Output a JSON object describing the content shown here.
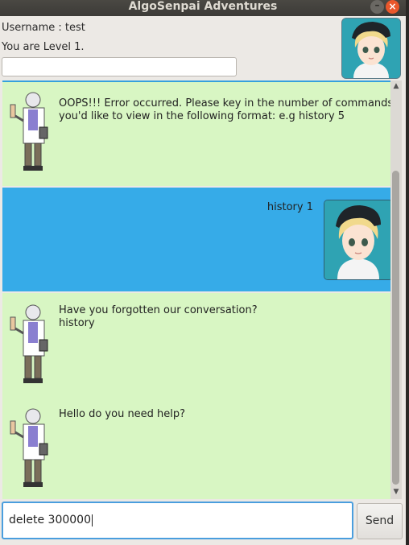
{
  "window": {
    "title": "AlgoSenpai Adventures",
    "minimize_glyph": "–",
    "close_glyph": "×"
  },
  "header": {
    "username": "Username : test",
    "level": "You are Level 1."
  },
  "messages": [
    {
      "speaker": "bot",
      "text": "OOPS!!! Error occurred. Please key in the number of commands\nyou'd like to view in the following format: e.g history 5"
    },
    {
      "speaker": "user",
      "text": "history 1"
    },
    {
      "speaker": "bot",
      "text": "Have you forgotten our conversation?\nhistory"
    },
    {
      "speaker": "bot",
      "text": "Hello do you need help?"
    }
  ],
  "input": {
    "value": "delete 300000"
  },
  "send_button": {
    "label": "Send"
  },
  "colors": {
    "bot_bubble": "#d8f6c3",
    "user_bubble": "#36abe8",
    "accent": "#35a0dd"
  }
}
